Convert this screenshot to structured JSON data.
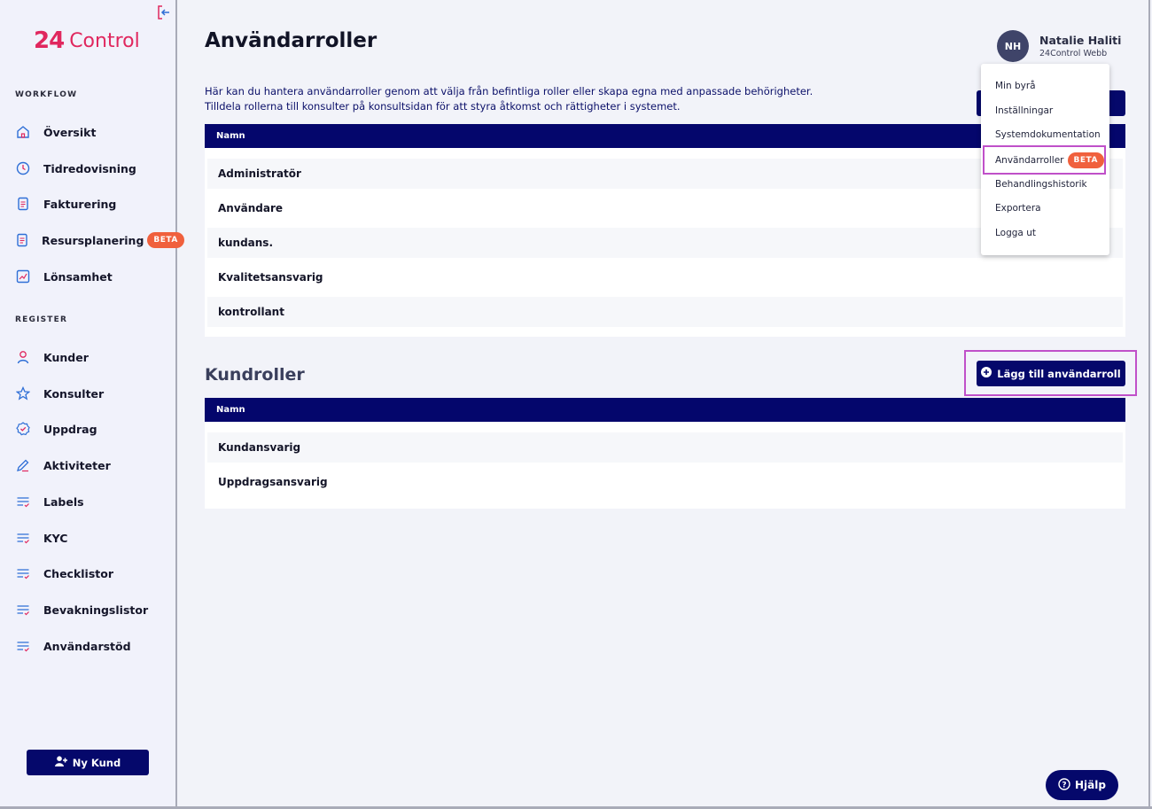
{
  "sidebar": {
    "logo_mark": "24",
    "logo_text": "Control",
    "workflow_label": "WORKFLOW",
    "register_label": "REGISTER",
    "workflow_items": [
      {
        "label": "Översikt",
        "icon": "home-icon"
      },
      {
        "label": "Tidredovisning",
        "icon": "clock-icon"
      },
      {
        "label": "Fakturering",
        "icon": "document-icon"
      },
      {
        "label": "Resursplanering",
        "icon": "document-icon",
        "badge": "BETA"
      },
      {
        "label": "Lönsamhet",
        "icon": "chart-icon"
      }
    ],
    "register_items": [
      {
        "label": "Kunder",
        "icon": "person-icon"
      },
      {
        "label": "Konsulter",
        "icon": "star-icon"
      },
      {
        "label": "Uppdrag",
        "icon": "badge-check-icon"
      },
      {
        "label": "Aktiviteter",
        "icon": "pen-icon"
      },
      {
        "label": "Labels",
        "icon": "list-check-icon"
      },
      {
        "label": "KYC",
        "icon": "list-check-icon"
      },
      {
        "label": "Checklistor",
        "icon": "list-check-icon"
      },
      {
        "label": "Bevakningslistor",
        "icon": "list-check-icon"
      },
      {
        "label": "Användarstöd",
        "icon": "list-check-icon"
      }
    ],
    "new_customer_label": "Ny Kund"
  },
  "main": {
    "title": "Användarroller",
    "description_line1": "Här kan du hantera användarroller genom att välja från befintliga roller eller skapa egna med anpassade behörigheter.",
    "description_line2": "Tilldela rollerna till konsulter på konsultsidan för att styra åtkomst och rättigheter i systemet.",
    "user_roles_table": {
      "header": "Namn",
      "rows": [
        "Administratör",
        "Användare",
        "kundans.",
        "Kvalitetsansvarig",
        "kontrollant"
      ]
    },
    "customer_roles_title": "Kundroller",
    "add_role_label": "Lägg till användarroll",
    "customer_roles_table": {
      "header": "Namn",
      "rows": [
        "Kundansvarig",
        "Uppdragsansvarig"
      ]
    }
  },
  "user": {
    "initials": "NH",
    "name": "Natalie Haliti",
    "org": "24Control Webb"
  },
  "user_menu": {
    "items": [
      "Min byrå",
      "Inställningar",
      "Systemdokumentation",
      "Användarroller",
      "Behandlingshistorik",
      "Exportera",
      "Logga ut"
    ],
    "badge": "BETA"
  },
  "help_label": "Hjälp",
  "colors": {
    "brand": "#e0275e",
    "navy": "#05086b",
    "beta": "#f0603d",
    "highlight": "#c050c9"
  }
}
